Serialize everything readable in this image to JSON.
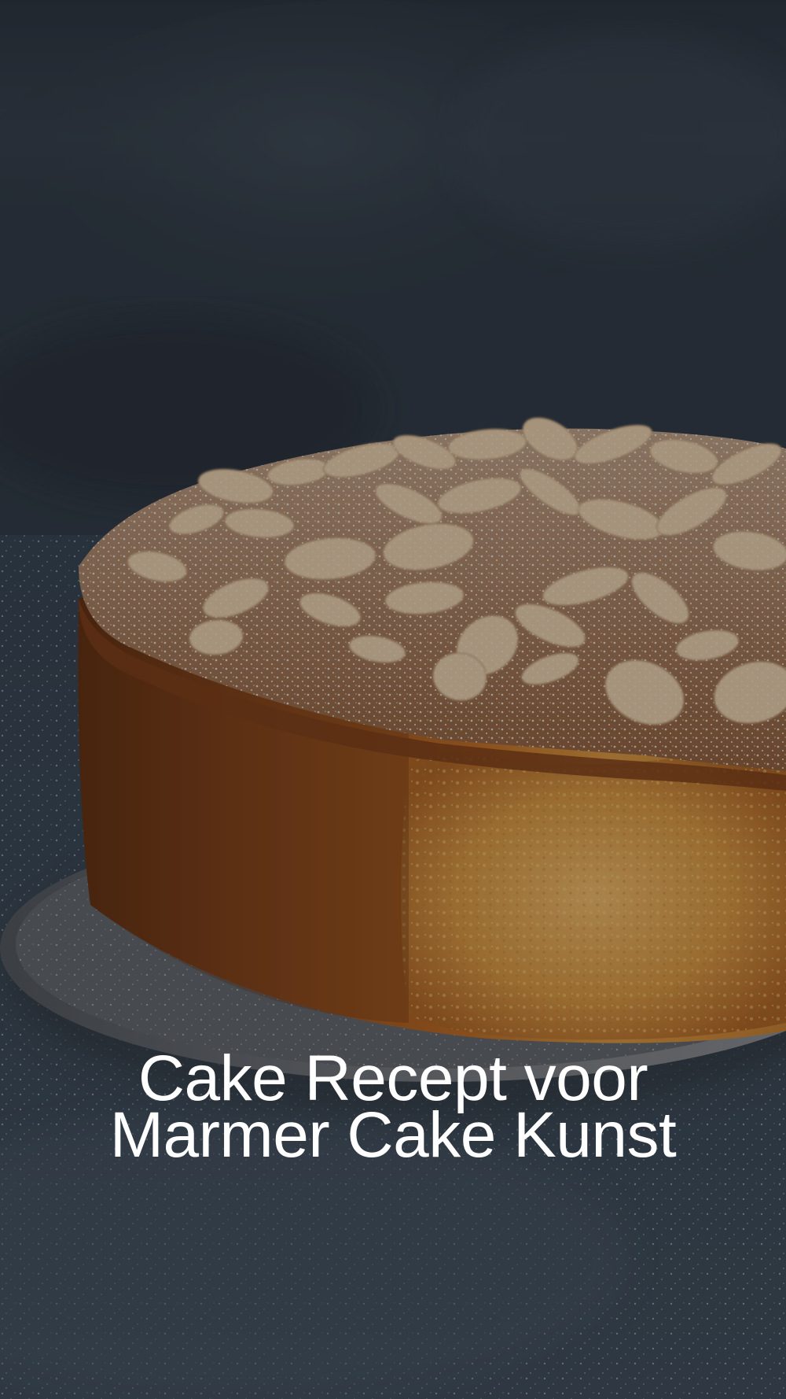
{
  "title": {
    "line1": "Cake Recept voor",
    "line2": "Marmer Cake Kunst"
  },
  "colors": {
    "text": "#ffffff",
    "backdrop": "#2b333c",
    "cake_crust": "#a8561c",
    "cake_crumb": "#d99a3c",
    "almond": "#e8cfae",
    "plate": "#6d6f72",
    "table": "#3b4652"
  }
}
